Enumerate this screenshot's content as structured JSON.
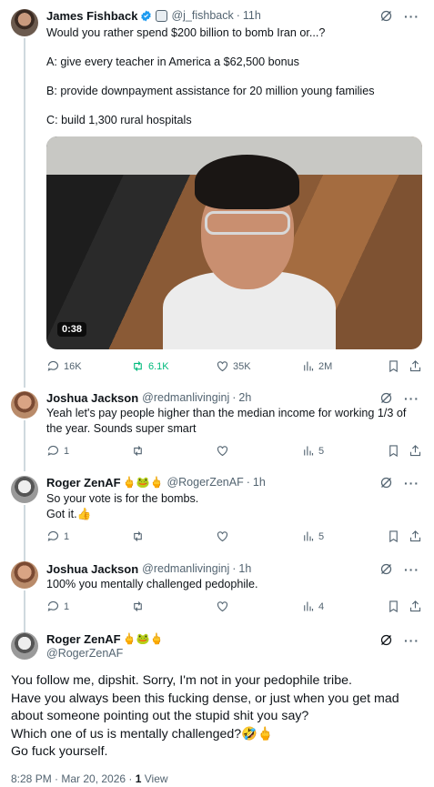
{
  "main_post": {
    "name": "James Fishback",
    "handle": "@j_fishback",
    "time": "11h",
    "lines": [
      "Would you rather spend $200 billion to bomb Iran or...?",
      "A: give every teacher in America a $62,500 bonus",
      "B: provide downpayment assistance for 20 million young families",
      "C: build 1,300 rural hospitals"
    ],
    "video_duration": "0:38",
    "replies": "16K",
    "reposts": "6.1K",
    "likes": "35K",
    "views": "2M"
  },
  "replies": [
    {
      "name": "Joshua Jackson",
      "handle": "@redmanlivinginj",
      "time": "2h",
      "emojis": "",
      "lines": [
        "Yeah let's pay people higher than the median income for working 1/3 of the year. Sounds super smart"
      ],
      "reply_count": "1",
      "views": "5"
    },
    {
      "name": "Roger ZenAF",
      "handle": "@RogerZenAF",
      "time": "1h",
      "emojis": "🖕🐸🖕",
      "lines": [
        "So your vote is for the bombs.",
        "Got it.👍"
      ],
      "reply_count": "1",
      "views": "5"
    },
    {
      "name": "Joshua Jackson",
      "handle": "@redmanlivinginj",
      "time": "1h",
      "emojis": "",
      "lines": [
        "100% you mentally challenged pedophile."
      ],
      "reply_count": "1",
      "views": "4"
    }
  ],
  "focused_post": {
    "name": "Roger ZenAF",
    "emojis": "🖕🐸🖕",
    "handle": "@RogerZenAF",
    "lines": [
      "You follow me, dipshit. Sorry, I'm not in your pedophile tribe.",
      "Have you always been this fucking dense, or just when you get mad about someone pointing out the stupid shit you say?",
      "Which one of us is mentally challenged?🤣🖕",
      "Go fuck yourself."
    ],
    "timestamp": "8:28 PM · Mar 20, 2026 · ",
    "view_count": "1",
    "view_label": "View"
  },
  "colors": {
    "text": "#0f1419",
    "muted": "#536471",
    "verified": "#1d9bf0",
    "repost_active": "#00ba7c"
  }
}
